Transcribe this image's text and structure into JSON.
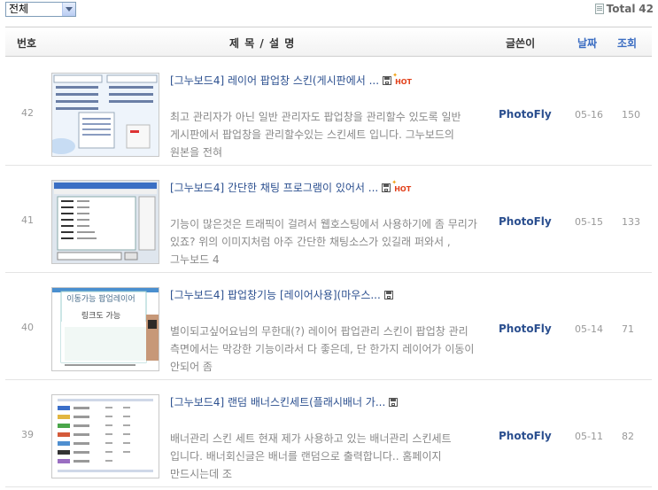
{
  "filter": {
    "selected": "전체"
  },
  "total": {
    "label": "Total",
    "count": "42"
  },
  "header": {
    "no": "번호",
    "title": "제 목 / 설 명",
    "writer": "글쓴이",
    "date": "날짜",
    "views": "조회"
  },
  "rows": [
    {
      "num": "42",
      "title": "[그누보드4] 레이어 팝업창 스킨(게시판에서 ...",
      "hot": true,
      "hot_label": "HOT",
      "desc": "최고 관리자가 아닌 일반 관리자도 팝업창을 관리할수 있도록 일반 게시판에서 팝업창을 관리할수있는 스킨세트 입니다. 그누보드의 원본을 전혀",
      "writer": "PhotoFly",
      "date": "05-16",
      "views": "150"
    },
    {
      "num": "41",
      "title": "[그누보드4] 간단한 채팅 프로그램이 있어서 ...",
      "hot": true,
      "hot_label": "HOT",
      "desc": "기능이 많은것은 트래픽이 걸려서 웹호스팅에서 사용하기에 좀 무리가 있죠? 위의 이미지처럼 아주 간단한 채팅소스가 있길래 퍼와서 , 그누보드 4",
      "writer": "PhotoFly",
      "date": "05-15",
      "views": "133"
    },
    {
      "num": "40",
      "title": "[그누보드4] 팝업창기능 [레이어사용](마우스...",
      "hot": false,
      "thumb_text_1": "이동가능 팝업레이어",
      "thumb_text_2": "링크도 가능",
      "desc": "별이되고싶어요님의 무한대(?) 레이어 팝업관리 스킨이 팝업창 관리 측면에서는 막강한 기능이라서 다 좋은데, 단 한가지 레이어가 이동이 안되어 좀",
      "writer": "PhotoFly",
      "date": "05-14",
      "views": "71"
    },
    {
      "num": "39",
      "title": "[그누보드4] 랜덤 배너스킨세트(플래시배너 가...",
      "hot": false,
      "desc": "배너관리 스킨 세트 현재 제가 사용하고 있는 배너관리 스킨세트 입니다. 배너회신글은 배너를 랜덤으로 출력합니다.. 홈페이지 만드시는데 조",
      "writer": "PhotoFly",
      "date": "05-11",
      "views": "82"
    }
  ]
}
